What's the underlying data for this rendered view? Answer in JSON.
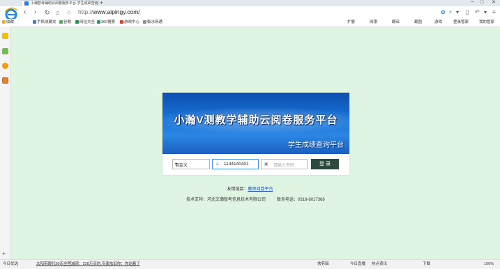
{
  "browser": {
    "tab_title": "小瀚智考辅助云阅卷服务平台-学生成绩查询",
    "new_tab": "+",
    "window_controls": [
      "─",
      "□",
      "✕"
    ],
    "url_proto": "http://",
    "url_host": "www.aipingy.com/",
    "nav": {
      "back": "‹",
      "forward": "›",
      "reload": "↻",
      "home": "⌂"
    },
    "toolbar_right": [
      "扩展",
      "网银",
      "翻译",
      "截图",
      "游戏",
      "登录管家",
      "我的管家"
    ]
  },
  "bookmarks": [
    {
      "label": "收藏",
      "color": "#f0b400"
    },
    {
      "label": "手机收藏夹",
      "color": "#3a7bd5"
    },
    {
      "label": "谷歌",
      "color": "#4caf50"
    },
    {
      "label": "网址大全",
      "color": "#2e8b57"
    },
    {
      "label": "360搜索",
      "color": "#1aa260"
    },
    {
      "label": "游戏中心",
      "color": "#e53935"
    },
    {
      "label": "衡水网通",
      "color": "#8e8e8e"
    }
  ],
  "page": {
    "banner_title": "小瀚V测教学辅助云阅卷服务平台",
    "banner_subtitle": "学生成绩查询平台",
    "login": {
      "school_select": "自定义",
      "username_value": "1144140401",
      "password_placeholder": "请输入密码",
      "login_button": "登 录"
    },
    "friend_links_label": "友情链接：",
    "friend_link": "教师阅卷平台",
    "support_text": "技术支持：河北文瀚智考信息技术有限公司",
    "phone_text": "联系电话：0318-8017368"
  },
  "statusbar": {
    "left": "今日优选",
    "news": "太阳带眼代50币全程减资：228万买的,专家依旧你：你站着了",
    "right": [
      "快剪辑",
      "今日直播",
      "热点资讯",
      "下载",
      "100%"
    ]
  }
}
